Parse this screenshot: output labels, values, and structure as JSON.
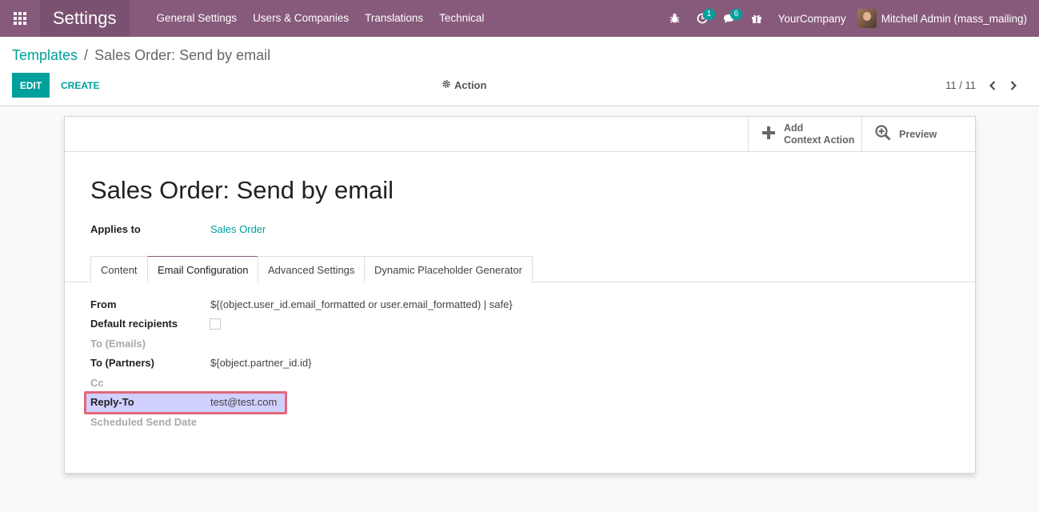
{
  "navbar": {
    "app_title": "Settings",
    "menu": [
      "General Settings",
      "Users & Companies",
      "Translations",
      "Technical"
    ],
    "activity_count": "1",
    "messages_count": "6",
    "company": "YourCompany",
    "user": "Mitchell Admin (mass_mailing)"
  },
  "breadcrumb": {
    "parent": "Templates",
    "separator": "/",
    "current": "Sales Order: Send by email"
  },
  "control": {
    "edit": "EDIT",
    "create": "CREATE",
    "action": "Action",
    "pager": "11 / 11"
  },
  "button_box": {
    "context_line1": "Add",
    "context_line2": "Context Action",
    "preview": "Preview"
  },
  "record": {
    "title": "Sales Order: Send by email",
    "applies_label": "Applies to",
    "applies_value": "Sales Order"
  },
  "tabs": [
    "Content",
    "Email Configuration",
    "Advanced Settings",
    "Dynamic Placeholder Generator"
  ],
  "fields": {
    "from_label": "From",
    "from_value": "${(object.user_id.email_formatted or user.email_formatted) | safe}",
    "default_recipients_label": "Default recipients",
    "to_emails_label": "To (Emails)",
    "to_partners_label": "To (Partners)",
    "to_partners_value": "${object.partner_id.id}",
    "cc_label": "Cc",
    "reply_to_label": "Reply-To",
    "reply_to_value": "test@test.com",
    "scheduled_label": "Scheduled Send Date"
  },
  "colors": {
    "brand": "#875a7b",
    "accent": "#00a09d",
    "highlight_border": "#e3667a"
  }
}
